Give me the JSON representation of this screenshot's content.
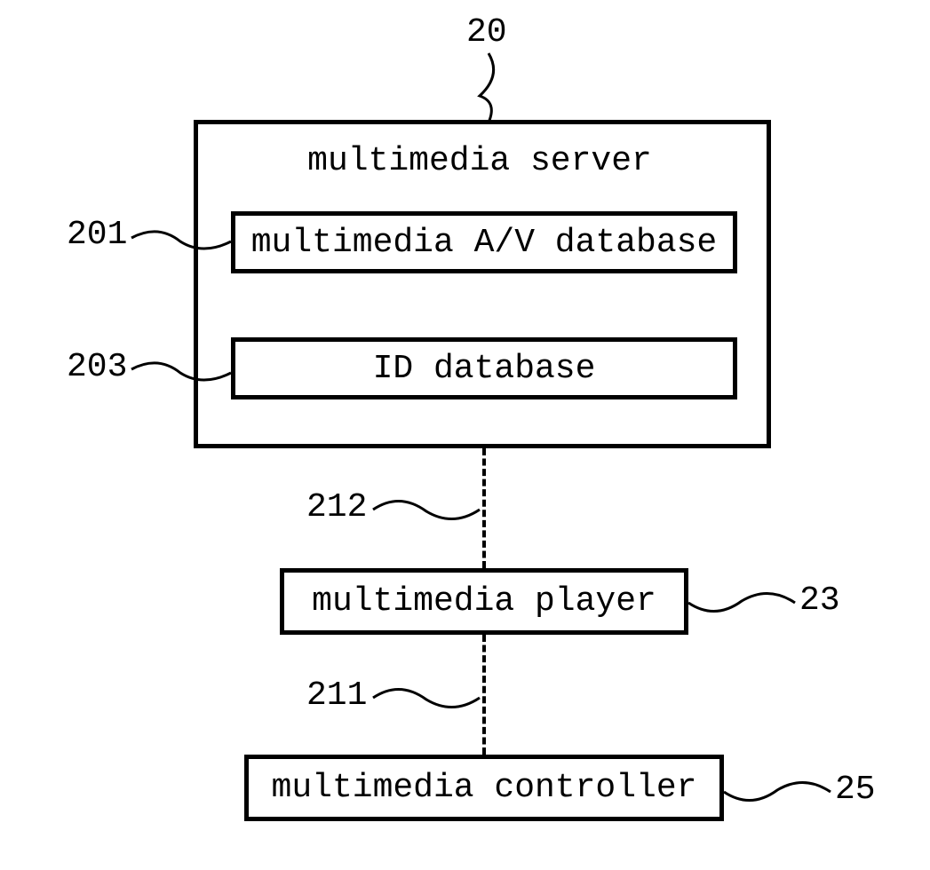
{
  "figure": {
    "top_ref": "20",
    "server": {
      "title": "multimedia server",
      "inner1": {
        "ref": "201",
        "label": "multimedia A/V database"
      },
      "inner2": {
        "ref": "203",
        "label": "ID database"
      }
    },
    "conn1_ref": "212",
    "player": {
      "ref": "23",
      "label": "multimedia player"
    },
    "conn2_ref": "211",
    "controller": {
      "ref": "25",
      "label": "multimedia controller"
    }
  }
}
